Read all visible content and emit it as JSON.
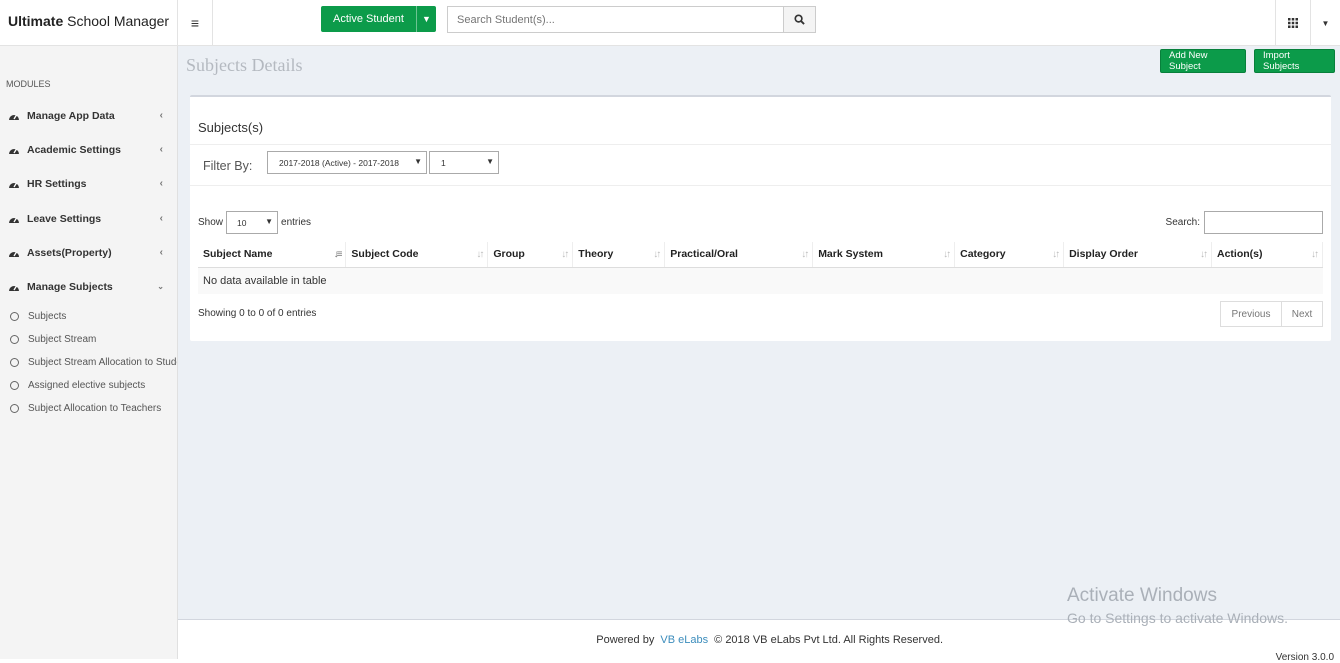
{
  "brand": {
    "bold": "Ultimate",
    "rest": " School Manager"
  },
  "topbar": {
    "active_student": "Active Student",
    "search_placeholder": "Search Student(s)..."
  },
  "sidebar": {
    "modules_label": "MODULES",
    "items": [
      {
        "label": "Manage App Data"
      },
      {
        "label": "Academic Settings"
      },
      {
        "label": "HR Settings"
      },
      {
        "label": "Leave Settings"
      },
      {
        "label": "Assets(Property)"
      },
      {
        "label": "Manage Subjects"
      }
    ],
    "subitems": [
      {
        "label": "Subjects"
      },
      {
        "label": "Subject Stream"
      },
      {
        "label": "Subject Stream Allocation to Students"
      },
      {
        "label": "Assigned elective subjects"
      },
      {
        "label": "Subject Allocation to Teachers"
      }
    ]
  },
  "page": {
    "title": "Subjects Details",
    "add_button": "Add New Subject",
    "import_button": "Import Subjects"
  },
  "panel": {
    "title": "Subjects(s)",
    "filter_label": "Filter By:",
    "session_select": "2017-2018 (Active) - 2017-2018",
    "class_select": "1",
    "show_label": "Show",
    "entries_value": "10",
    "entries_label": "entries",
    "search_label": "Search:",
    "columns": [
      "Subject Name",
      "Subject Code",
      "Group",
      "Theory",
      "Practical/Oral",
      "Mark System",
      "Category",
      "Display Order",
      "Action(s)"
    ],
    "empty_message": "No data available in table",
    "info": "Showing 0 to 0 of 0 entries",
    "prev": "Previous",
    "next": "Next"
  },
  "watermark": {
    "line1": "Activate Windows",
    "line2": "Go to Settings to activate Windows."
  },
  "footer": {
    "powered_by": "Powered by",
    "company_link": "VB eLabs",
    "copyright": "© 2018 VB eLabs Pvt Ltd. All Rights Reserved.",
    "version": "Version 3.0.0"
  },
  "colors": {
    "accent_green": "#0c9b4a",
    "link_blue": "#3c8dbc",
    "content_bg": "#ecf0f5"
  }
}
